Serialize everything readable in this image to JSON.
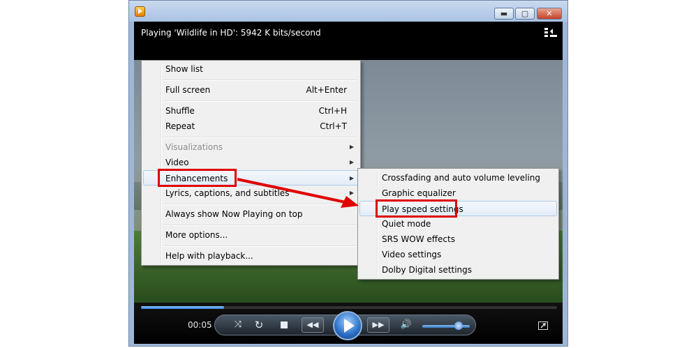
{
  "window": {
    "controls": {
      "minimize": "▬",
      "maximize": "▢",
      "close": "✕"
    }
  },
  "player": {
    "status": "Playing 'Wildlife in HD': 5942 K bits/second",
    "time": "00:05",
    "seek_progress": 0.2
  },
  "main_menu": {
    "items": [
      {
        "label": "Show list",
        "shortcut": ""
      },
      {
        "label": "Full screen",
        "shortcut": "Alt+Enter"
      },
      {
        "label": "Shuffle",
        "shortcut": "Ctrl+H"
      },
      {
        "label": "Repeat",
        "shortcut": "Ctrl+T"
      },
      {
        "label": "Visualizations",
        "shortcut": ""
      },
      {
        "label": "Video",
        "shortcut": ""
      },
      {
        "label": "Enhancements",
        "shortcut": ""
      },
      {
        "label": "Lyrics, captions, and subtitles",
        "shortcut": ""
      },
      {
        "label": "Always show Now Playing on top",
        "shortcut": ""
      },
      {
        "label": "More options...",
        "shortcut": ""
      },
      {
        "label": "Help with playback...",
        "shortcut": ""
      }
    ]
  },
  "sub_menu": {
    "items": [
      {
        "label": "Crossfading and auto volume leveling"
      },
      {
        "label": "Graphic equalizer"
      },
      {
        "label": "Play speed settings"
      },
      {
        "label": "Quiet mode"
      },
      {
        "label": "SRS WOW effects"
      },
      {
        "label": "Video settings"
      },
      {
        "label": "Dolby Digital settings"
      }
    ]
  },
  "colors": {
    "highlight": "#e00000",
    "accent": "#2f7ed8"
  }
}
